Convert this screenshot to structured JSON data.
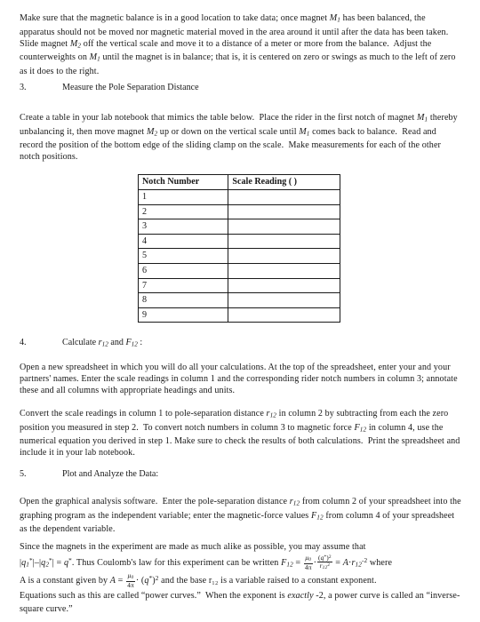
{
  "document": {
    "type": "lab-manual-page",
    "background_color": "#ffffff",
    "text_color": "#181818"
  },
  "paragraphs": {
    "intro": "Make sure that the magnetic balance is in a good location to take data; once magnet M₁ has been balanced, the apparatus should not be moved nor magnetic material moved in the area around it until after the data has been taken. Slide magnet M₂ off the vertical scale and move it to a distance of a meter or more from the balance. Adjust the counterweights on M₁ until the magnet is in balance; that is, it is centered on zero or swings as much to the left of zero as it does to the right.",
    "step3_body": "Create a table in your lab notebook that mimics the table below. Place the rider in the first notch of magnet M₁ thereby unbalancing it, then move magnet M₂ up or down on the vertical scale until M₁ comes back to balance. Read and record the position of the bottom edge of the sliding clamp on the scale. Make measurements for each of the other notch positions.",
    "step4_body1": "Open a new spreadsheet in which you will do all your calculations. At the top of the spreadsheet, enter your and your partners' names. Enter the scale readings in column 1 and the corresponding rider notch numbers in column 3; annotate these and all columns with appropriate headings and units.",
    "step4_body2": "Convert the scale readings in column 1 to pole-separation distance r₁₂ in column 2 by subtracting from each the zero position you measured in step 2. To convert notch numbers in column 3 to magnetic force F₁₂ in column 4, use the numerical equation you derived in step 1. Make sure to check the results of both calculations. Print the spreadsheet and include it in your lab notebook.",
    "step5_body1": "Open the graphical analysis software. Enter the pole-separation distance r₁₂ from column 2 of your spreadsheet into the graphing program as the independent variable; enter the magnetic-force values F₁₂ from column 4 of your spreadsheet as the dependent variable.",
    "step5_body2_lead": "Since the magnets in the experiment are made as much alike as possible, you may assume that",
    "step5_body2_tail": "Equations such as this are called “power curves.” When the exponent is exactly -2, a power curve is called an “inverse-square curve.”"
  },
  "sections": [
    {
      "number": "3.",
      "title": "Measure the Pole Separation Distance"
    },
    {
      "number": "4.",
      "title": "Calculate r₁₂ and F₁₂ :"
    },
    {
      "number": "5.",
      "title": "Plot and Analyze the Data:"
    }
  ],
  "table": {
    "headers": [
      "Notch Number",
      "Scale Reading (    )"
    ],
    "rows": [
      [
        "1",
        ""
      ],
      [
        "2",
        ""
      ],
      [
        "3",
        ""
      ],
      [
        "4",
        ""
      ],
      [
        "5",
        ""
      ],
      [
        "6",
        ""
      ],
      [
        "7",
        ""
      ],
      [
        "8",
        ""
      ],
      [
        "9",
        ""
      ]
    ]
  },
  "equations": {
    "charge_equality": "|q₁*|=|q₂*| = q*.",
    "coulomb_lead": "Thus Coulomb's law for this experiment can be written",
    "coulomb_main": "F₁₂ = (μ₀/4π)·((q*)²/r₁₂²) = A·r₁₂⁻²",
    "coulomb_trail": "where",
    "constant_lead": "A is a constant given by",
    "constant_main": "A = (μ₀/4π)·(q*)²",
    "constant_trail": "and the base r₁₂ is a variable raised to a constant exponent."
  }
}
